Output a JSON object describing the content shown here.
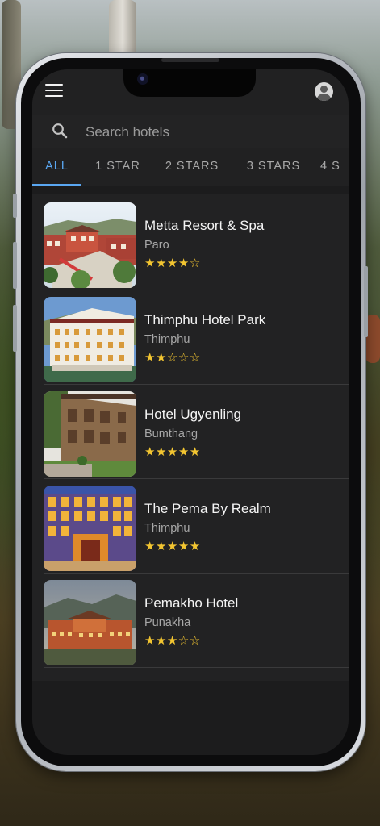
{
  "header": {
    "menu_icon": "menu-icon",
    "account_icon": "account-circle-icon"
  },
  "search": {
    "placeholder": "Search hotels",
    "value": ""
  },
  "tabs": [
    {
      "label": "ALL",
      "active": true
    },
    {
      "label": "1 STAR",
      "active": false
    },
    {
      "label": "2 STARS",
      "active": false
    },
    {
      "label": "3 STARS",
      "active": false
    },
    {
      "label": "4 S",
      "active": false
    }
  ],
  "hotels": [
    {
      "name": "Metta Resort & Spa",
      "location": "Paro",
      "rating": 4,
      "max_rating": 5
    },
    {
      "name": "Thimphu Hotel Park",
      "location": "Thimphu",
      "rating": 2,
      "max_rating": 5
    },
    {
      "name": "Hotel Ugyenling",
      "location": "Bumthang",
      "rating": 5,
      "max_rating": 5
    },
    {
      "name": "The Pema By Realm",
      "location": "Thimphu",
      "rating": 5,
      "max_rating": 5
    },
    {
      "name": "Pemakho Hotel",
      "location": "Punakha",
      "rating": 3,
      "max_rating": 5
    }
  ],
  "colors": {
    "accent": "#5aa7f2",
    "star": "#f2c531",
    "background": "#1c1c1d"
  }
}
